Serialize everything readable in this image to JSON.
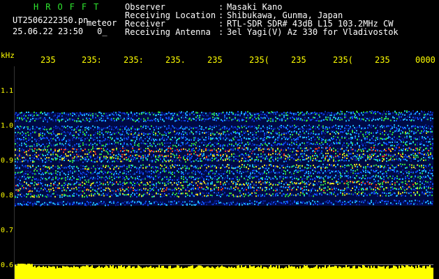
{
  "header": {
    "brand": "HROFFT",
    "filename": "UT2506222350.pn",
    "meteor": "meteor",
    "datetime": "25.06.22 23:50",
    "datetime_extra": "0_"
  },
  "info": [
    {
      "key": "Observer",
      "value": "Masaki Kano"
    },
    {
      "key": "Receiving Location",
      "value": "Shibukawa, Gunma, Japan"
    },
    {
      "key": "Receiver",
      "value": "RTL-SDR SDR# 43dB L15 103.2MHz CW"
    },
    {
      "key": "Receiving Antenna",
      "value": "3el Yagi(V) Az 330 for Vladivostok"
    }
  ],
  "axes": {
    "y_unit": "kHz",
    "y_ticks": [
      "1.1",
      "1.0",
      "0.9",
      "0.8",
      "0.7",
      "0.6"
    ],
    "x_ticks": [
      "235",
      "235:",
      "235:",
      "235.",
      "235",
      "235(",
      "235",
      "235(",
      "235",
      "0000"
    ]
  },
  "colors": {
    "brand": "#2ee62e",
    "axis": "#ffff00",
    "noise": "#ffff00",
    "background": "#000000"
  }
}
